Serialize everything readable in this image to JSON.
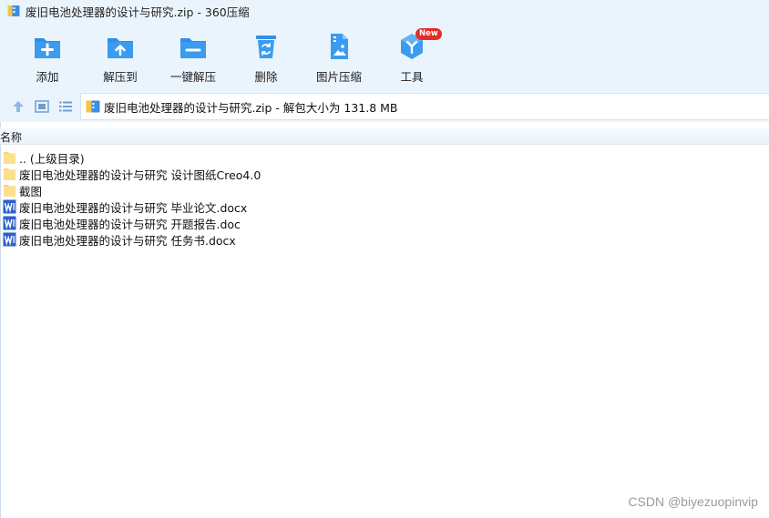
{
  "window": {
    "title": "废旧电池处理器的设计与研究.zip - 360压缩"
  },
  "toolbar": {
    "items": [
      {
        "label": "添加",
        "icon": "add-folder-icon"
      },
      {
        "label": "解压到",
        "icon": "extract-to-icon"
      },
      {
        "label": "一键解压",
        "icon": "one-click-extract-icon"
      },
      {
        "label": "删除",
        "icon": "recycle-bin-icon"
      },
      {
        "label": "图片压缩",
        "icon": "image-compress-icon"
      },
      {
        "label": "工具",
        "icon": "tools-cube-icon",
        "badge": "New"
      }
    ]
  },
  "address": {
    "path": "废旧电池处理器的设计与研究.zip - 解包大小为 131.8 MB"
  },
  "columns": {
    "name": "名称"
  },
  "files": [
    {
      "name": ".. (上级目录)",
      "type": "folder"
    },
    {
      "name": "废旧电池处理器的设计与研究 设计图纸Creo4.0",
      "type": "folder"
    },
    {
      "name": "截图",
      "type": "folder"
    },
    {
      "name": "废旧电池处理器的设计与研究 毕业论文.docx",
      "type": "word"
    },
    {
      "name": "废旧电池处理器的设计与研究 开题报告.doc",
      "type": "word"
    },
    {
      "name": "废旧电池处理器的设计与研究 任务书.docx",
      "type": "word"
    }
  ],
  "watermark": "CSDN @biyezuopinvip",
  "colors": {
    "toolbar_bg": "#eaf4fd",
    "icon_blue": "#2f8fe6",
    "folder_yellow": "#f8d775",
    "word_blue": "#2b5fc9",
    "badge_red": "#e52b2b"
  }
}
